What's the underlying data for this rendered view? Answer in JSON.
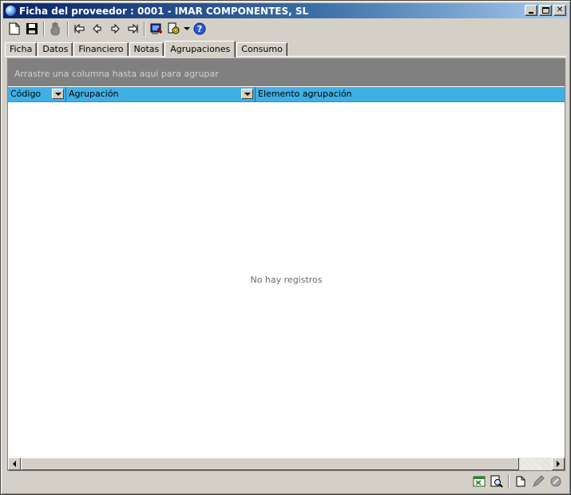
{
  "window": {
    "title": "Ficha del proveedor :  0001 - IMAR COMPONENTES, SL"
  },
  "toolbar": {
    "icons": [
      "new-document-icon",
      "save-icon",
      "hand-icon",
      "first-record-icon",
      "previous-record-icon",
      "next-record-icon",
      "last-record-icon",
      "report-icon",
      "tools-icon",
      "help-icon"
    ]
  },
  "tabs": [
    {
      "label": "Ficha",
      "active": false
    },
    {
      "label": "Datos",
      "active": false
    },
    {
      "label": "Financiero",
      "active": false
    },
    {
      "label": "Notas",
      "active": false
    },
    {
      "label": "Agrupaciones",
      "active": true
    },
    {
      "label": "Consumo",
      "active": false
    }
  ],
  "grid": {
    "group_panel_text": "Arrastre una columna hasta aquí para agrupar",
    "columns": [
      "Código",
      "Agrupación",
      "Elemento agrupación"
    ],
    "empty_text": "No hay registros"
  },
  "colors": {
    "header_blue": "#3fb0e6",
    "group_panel_gray": "#808080",
    "titlebar_start": "#0a246a",
    "titlebar_end": "#a6caf0"
  }
}
